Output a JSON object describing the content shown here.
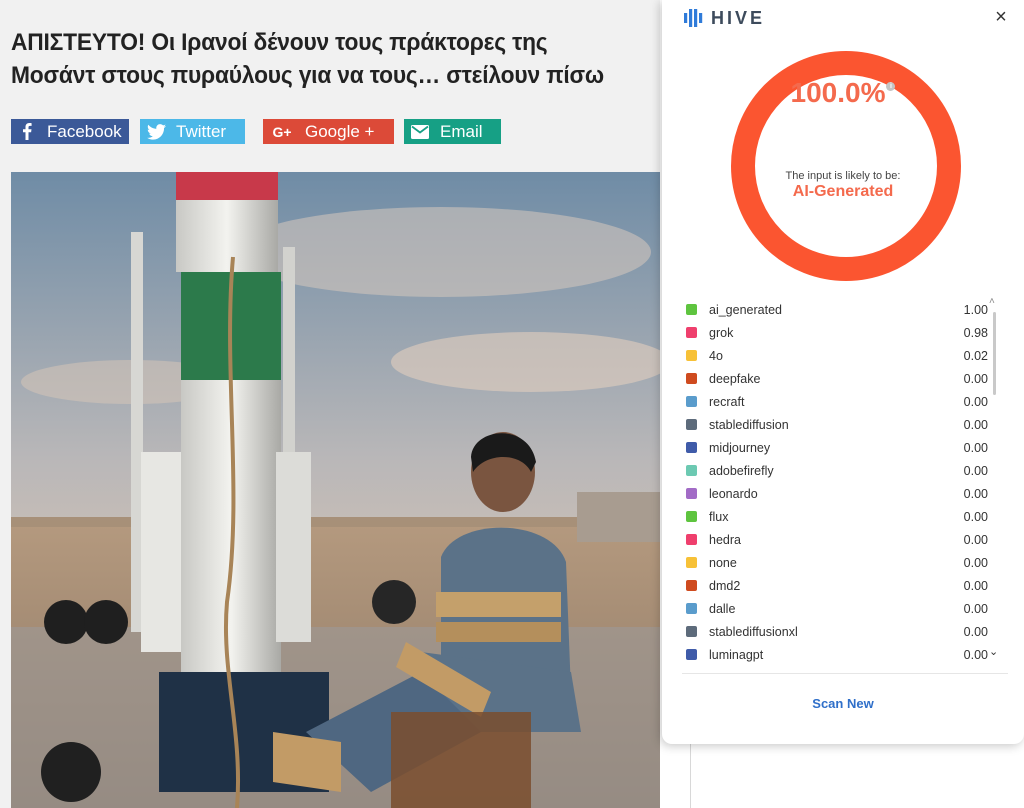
{
  "article": {
    "headline_line1": "ΑΠΙΣΤΕΥΤΟ! Οι Ιρανοί δένουν τους πράκτορες της",
    "headline_line2": "Μοσάντ στους πυραύλους για να τους… στείλουν πίσω",
    "share": {
      "facebook": "Facebook",
      "twitter": "Twitter",
      "google": "Google +",
      "email": "Email"
    }
  },
  "colors": {
    "facebook": "#3b5998",
    "twitter": "#4cb8e8",
    "google": "#dc4a38",
    "email": "#16a085",
    "ring": "#fb5530",
    "accent_text": "#f46a4d",
    "link": "#2f6fc9"
  },
  "hive": {
    "brand": "HIVE",
    "score": "100.0%",
    "likely_label": "The input is likely to be:",
    "verdict": "AI-Generated",
    "scan_new": "Scan New",
    "results": [
      {
        "name": "ai_generated",
        "value": "1.00",
        "color": "#5ec43f"
      },
      {
        "name": "grok",
        "value": "0.98",
        "color": "#ef3f6d"
      },
      {
        "name": "4o",
        "value": "0.02",
        "color": "#f7c137"
      },
      {
        "name": "deepfake",
        "value": "0.00",
        "color": "#cf4b1f"
      },
      {
        "name": "recraft",
        "value": "0.00",
        "color": "#5a9ccc"
      },
      {
        "name": "stablediffusion",
        "value": "0.00",
        "color": "#5d6b7b"
      },
      {
        "name": "midjourney",
        "value": "0.00",
        "color": "#3f5ba9"
      },
      {
        "name": "adobefirefly",
        "value": "0.00",
        "color": "#6cc9b2"
      },
      {
        "name": "leonardo",
        "value": "0.00",
        "color": "#a26bc6"
      },
      {
        "name": "flux",
        "value": "0.00",
        "color": "#5ec43f"
      },
      {
        "name": "hedra",
        "value": "0.00",
        "color": "#ef3f6d"
      },
      {
        "name": "none",
        "value": "0.00",
        "color": "#f7c137"
      },
      {
        "name": "dmd2",
        "value": "0.00",
        "color": "#cf4b1f"
      },
      {
        "name": "dalle",
        "value": "0.00",
        "color": "#5a9ccc"
      },
      {
        "name": "stablediffusionxl",
        "value": "0.00",
        "color": "#5d6b7b"
      },
      {
        "name": "luminagpt",
        "value": "0.00",
        "color": "#3f5ba9"
      }
    ]
  }
}
